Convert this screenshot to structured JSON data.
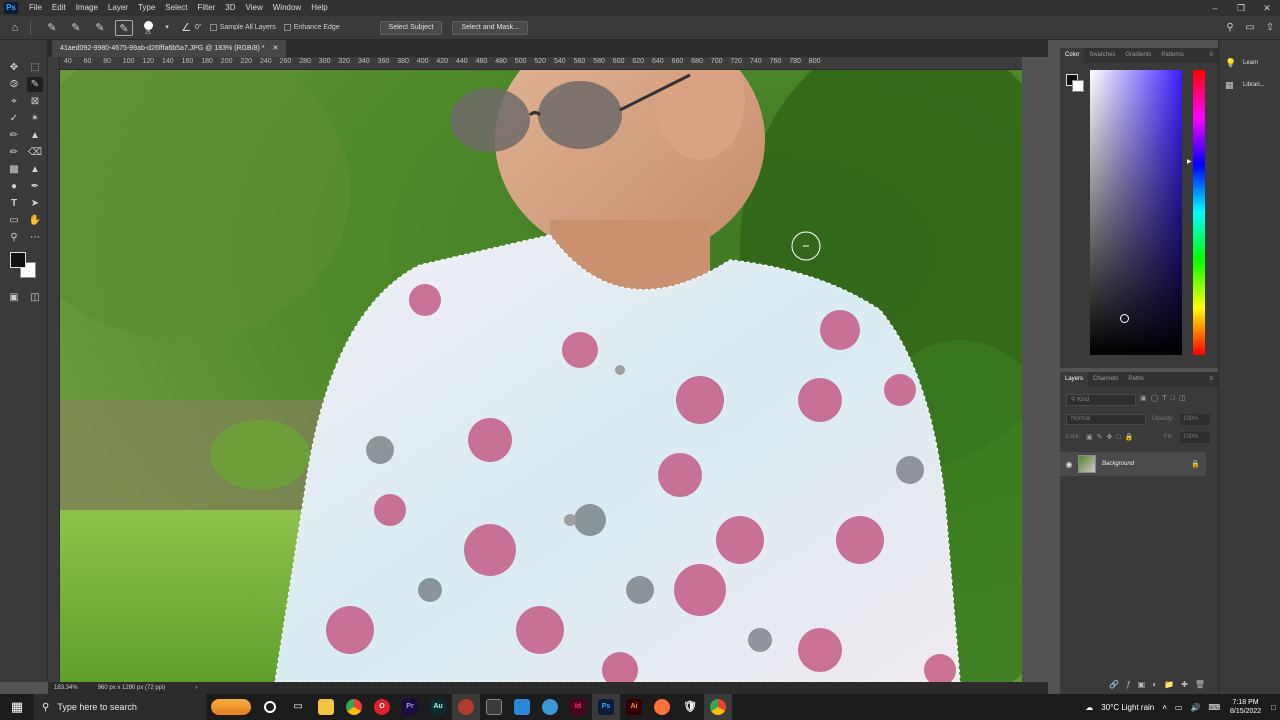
{
  "menubar": {
    "logo": "Ps",
    "items": [
      "File",
      "Edit",
      "Image",
      "Layer",
      "Type",
      "Select",
      "Filter",
      "3D",
      "View",
      "Window",
      "Help"
    ]
  },
  "options": {
    "brush_size": "25",
    "angle": "0°",
    "sample_all_layers": "Sample All Layers",
    "enhance_edge": "Enhance Edge",
    "select_subject": "Select Subject",
    "select_and_mask": "Select and Mask..."
  },
  "document": {
    "tab_title": "41aed092-9980-4675-99ab-d26fffa6b5a7.JPG @ 183% (RGB/8) *",
    "zoom": "183.34%",
    "dimensions": "960 px x 1280 px (72 ppi)"
  },
  "ruler": {
    "ticks": [
      "40",
      "60",
      "80",
      "100",
      "120",
      "140",
      "160",
      "180",
      "200",
      "220",
      "240",
      "260",
      "280",
      "300",
      "320",
      "340",
      "360",
      "380",
      "400",
      "420",
      "440",
      "460",
      "480",
      "500",
      "520",
      "540",
      "560",
      "580",
      "600",
      "620",
      "640",
      "660",
      "680",
      "700",
      "720",
      "740",
      "760",
      "780",
      "800"
    ]
  },
  "color_panel": {
    "tabs": [
      "Color",
      "Swatches",
      "Gradients",
      "Patterns"
    ]
  },
  "layers_panel": {
    "tabs": [
      "Layers",
      "Channels",
      "Paths"
    ],
    "kind_placeholder": "Kind",
    "blend_mode": "Normal",
    "opacity_label": "Opacity:",
    "opacity_value": "100%",
    "lock_label": "Lock:",
    "fill_label": "Fill:",
    "fill_value": "100%",
    "layer_name": "Background"
  },
  "far_right": {
    "learn": "Learn",
    "libraries": "Librari..."
  },
  "taskbar": {
    "search_placeholder": "Type here to search",
    "weather": "30°C  Light rain",
    "time": "7:18 PM",
    "date": "8/15/2022"
  },
  "colors": {
    "accent": "#31a8ff",
    "hue_top": "#ff0000",
    "picker_base": "#3b1fff"
  }
}
